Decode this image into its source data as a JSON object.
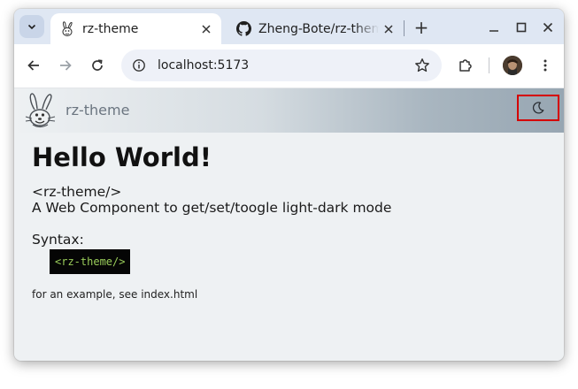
{
  "browser": {
    "tabs": [
      {
        "title": "rz-theme",
        "active": true,
        "favicon": "bunny-logo-icon"
      },
      {
        "title": "Zheng-Bote/rz-theme",
        "active": false,
        "favicon": "github-icon"
      }
    ],
    "new_tab_symbol": "+",
    "url": "localhost:5173",
    "icons": [
      "chevron-down-icon",
      "close-icon",
      "plus-icon",
      "minimize-icon",
      "maximize-icon",
      "back-arrow-icon",
      "forward-arrow-icon",
      "reload-icon",
      "site-info-icon",
      "star-icon",
      "extensions-icon",
      "avatar",
      "kebab-menu-icon"
    ]
  },
  "page": {
    "brand": "rz-theme",
    "theme_toggle_icon": "moon-icon",
    "heading": "Hello World!",
    "component_tag": "<rz-theme/>",
    "description": "A Web Component to get/set/toogle light-dark mode",
    "syntax_label": "Syntax:",
    "syntax_code": "<rz-theme/>",
    "example_note": "for an example, see index.html"
  },
  "colors": {
    "highlight_border": "#d40000",
    "code_background": "#050505",
    "code_text": "#9acd5a"
  }
}
